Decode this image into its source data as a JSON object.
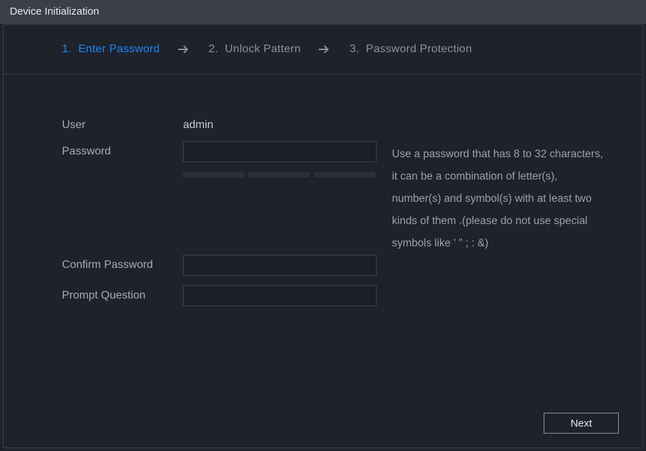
{
  "window": {
    "title": "Device Initialization"
  },
  "steps": [
    {
      "index": "1.",
      "label": "Enter Password",
      "active": true
    },
    {
      "index": "2.",
      "label": "Unlock Pattern",
      "active": false
    },
    {
      "index": "3.",
      "label": "Password Protection",
      "active": false
    }
  ],
  "form": {
    "user_label": "User",
    "user_value": "admin",
    "password_label": "Password",
    "password_value": "",
    "confirm_label": "Confirm Password",
    "confirm_value": "",
    "prompt_label": "Prompt Question",
    "prompt_value": ""
  },
  "hint": "Use a password that has 8 to 32 characters, it can be a combination of letter(s), number(s) and symbol(s) with at least two kinds of them .(please do not use special symbols like ' \" ; : &)",
  "footer": {
    "next_label": "Next"
  },
  "colors": {
    "accent": "#1989ff",
    "bg": "#1e222a",
    "border": "#3b404b"
  }
}
